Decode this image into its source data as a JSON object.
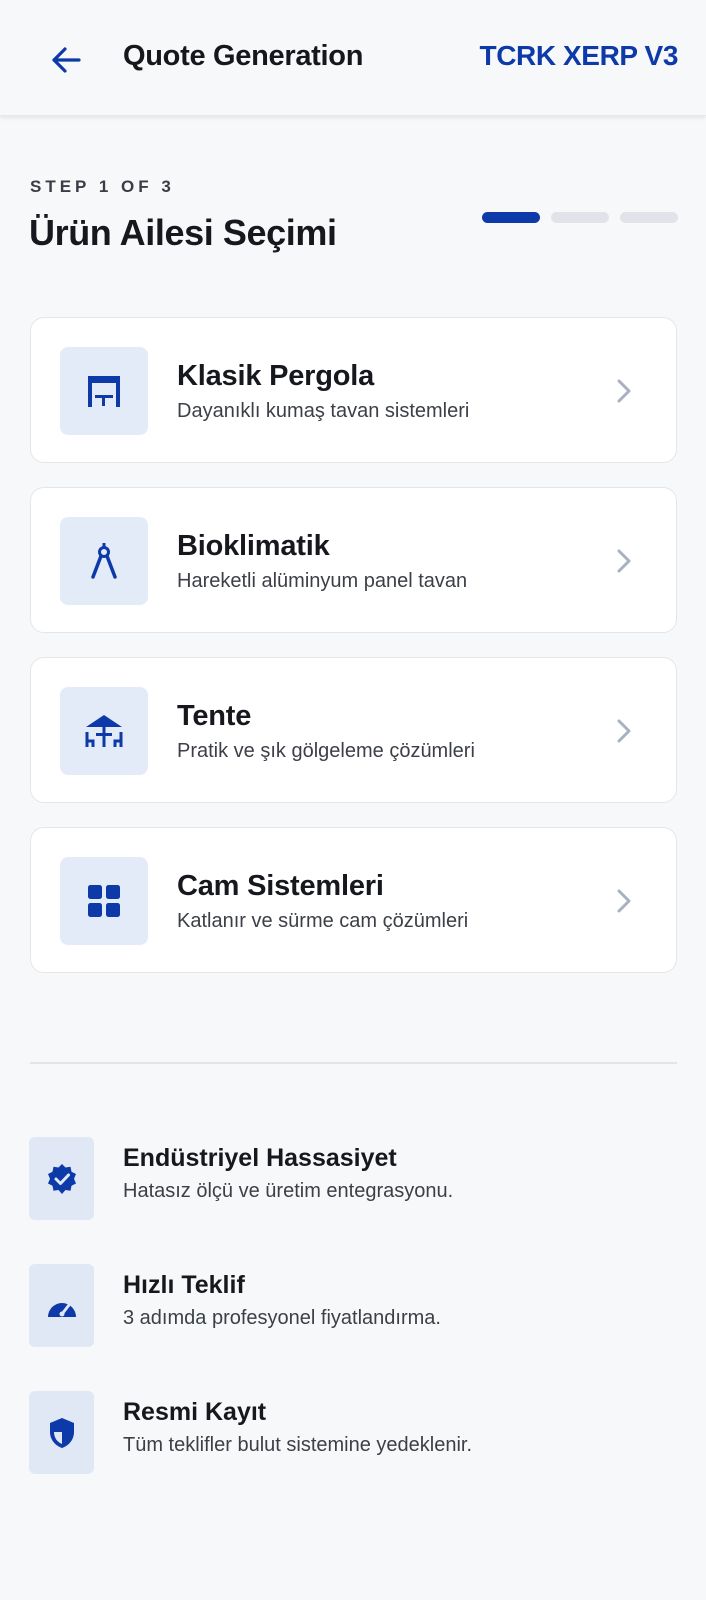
{
  "header": {
    "title": "Quote Generation",
    "brand": "TCRK XERP V3",
    "back_icon": "arrow-left-icon"
  },
  "step": {
    "label": "STEP 1 OF 3",
    "title": "Ürün Ailesi Seçimi",
    "current": 1,
    "total": 3
  },
  "colors": {
    "accent": "#0d3aa8",
    "icon_bg": "#e3ebf8",
    "progress_inactive": "#e1e3e8"
  },
  "families": [
    {
      "title": "Klasik Pergola",
      "subtitle": "Dayanıklı kumaş tavan sistemleri",
      "icon": "pergola-icon"
    },
    {
      "title": "Bioklimatik",
      "subtitle": "Hareketli alüminyum panel tavan",
      "icon": "compass-icon"
    },
    {
      "title": "Tente",
      "subtitle": "Pratik ve şık gölgeleme çözümleri",
      "icon": "cafe-awning-icon"
    },
    {
      "title": "Cam Sistemleri",
      "subtitle": "Katlanır ve sürme cam çözümleri",
      "icon": "window-grid-icon"
    }
  ],
  "features": [
    {
      "title": "Endüstriyel Hassasiyet",
      "subtitle": "Hatasız ölçü ve üretim entegrasyonu.",
      "icon": "verified-badge-icon"
    },
    {
      "title": "Hızlı Teklif",
      "subtitle": "3 adımda profesyonel fiyatlandırma.",
      "icon": "speedometer-icon"
    },
    {
      "title": "Resmi Kayıt",
      "subtitle": "Tüm teklifler bulut sistemine yedeklenir.",
      "icon": "shield-icon"
    }
  ]
}
